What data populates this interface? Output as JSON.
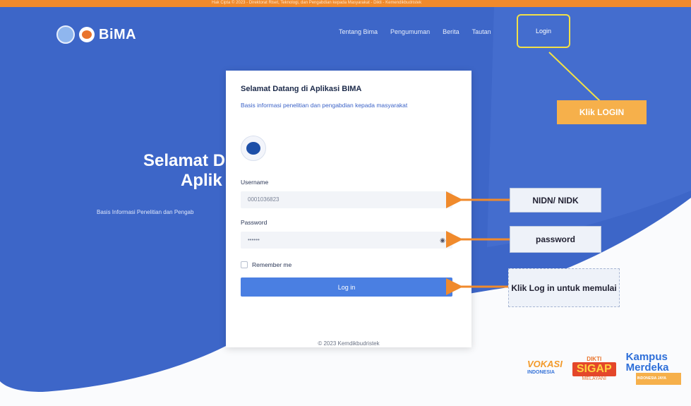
{
  "topbar": {
    "text": "Hak Cipta © 2023 - Direktorat Riset, Teknologi, dan Pengabdian kepada Masyarakat - Dikti - Kemendikbudristek"
  },
  "brand": {
    "name": "BiMA"
  },
  "nav": {
    "items": [
      "Tentang Bima",
      "Pengumuman",
      "Berita",
      "Tautan"
    ],
    "login": "Login"
  },
  "hero": {
    "title_line1": "Selamat D",
    "title_line2": "Aplik",
    "subtitle": "Basis Informasi Penelitian dan Pengab"
  },
  "card": {
    "title": "Selamat Datang di Aplikasi BIMA",
    "description": "Basis informasi penelitian dan pengabdian kepada masyarakat",
    "username_label": "Username",
    "username_value": "0001036823",
    "password_label": "Password",
    "password_value": "••••••",
    "remember_label": "Remember me",
    "login_button": "Log in",
    "copyright": "© 2023 Kemdikbudristek"
  },
  "annotations": {
    "login": "Klik LOGIN",
    "nidn": "NIDN/ NIDK",
    "password": "password",
    "start": "Klik Log in untuk memulai"
  },
  "partners": {
    "vokasi": "VOKASI",
    "vokasi_tag": "INDONESIA",
    "dikti": "DIKTI",
    "sigap": "SIGAP",
    "melayani": "MELAYANI",
    "kampus": "Kampus",
    "merdeka": "Merdeka",
    "merdeka_tag": "INDONESIA JAYA"
  },
  "colors": {
    "primary": "#3d66c8",
    "accent": "#f6b04b",
    "highlight": "#f2e047"
  }
}
